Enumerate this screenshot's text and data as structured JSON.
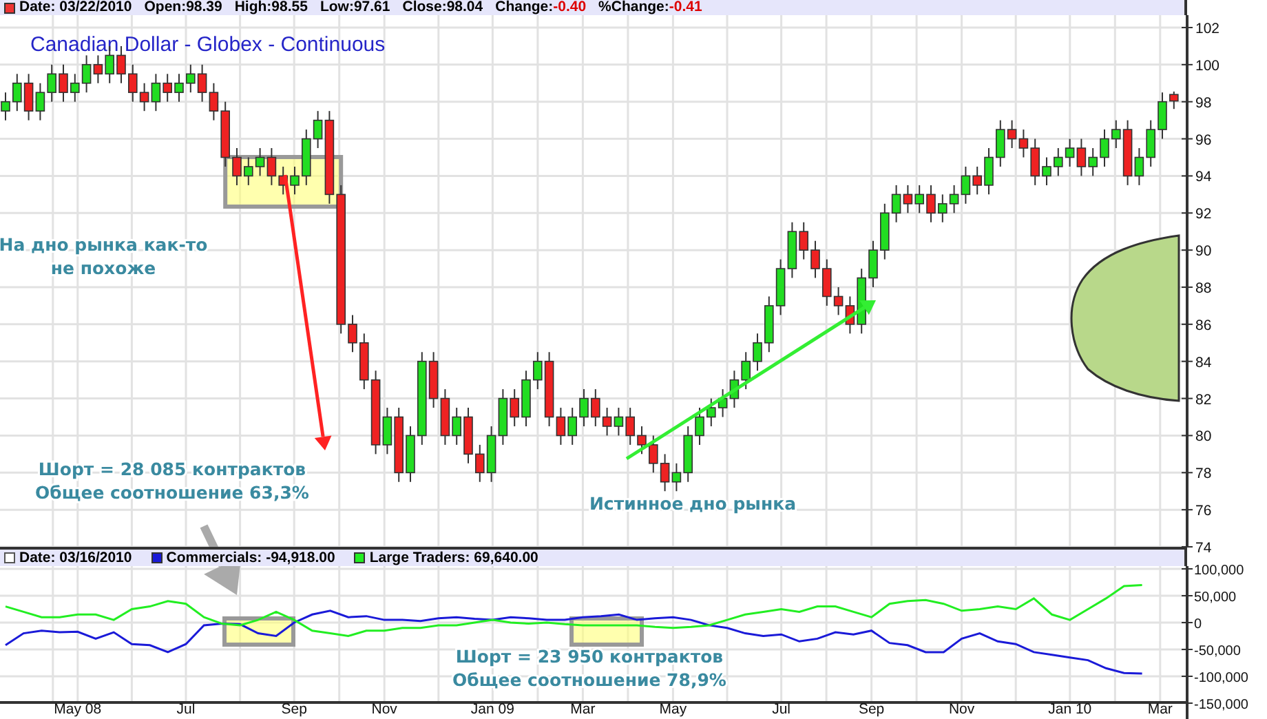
{
  "header": {
    "items": [
      {
        "kind": "date",
        "text": "Date: 03/22/2010"
      },
      {
        "kind": "plain",
        "text": "Open:98.39"
      },
      {
        "kind": "plain",
        "text": "High:98.55"
      },
      {
        "kind": "plain",
        "text": "Low:97.61"
      },
      {
        "kind": "plain",
        "text": "Close:98.04"
      },
      {
        "kind": "change",
        "label": "Change:",
        "value": "-0.40",
        "negative": true
      },
      {
        "kind": "change",
        "label": "%Change:",
        "value": "-0.41",
        "negative": true
      }
    ]
  },
  "price_chart": {
    "chart_data": {
      "type": "candlestick",
      "title": "Canadian Dollar - Globex - Continuous",
      "grid": true,
      "ylim": [
        74,
        102
      ],
      "yticks": [
        74,
        76,
        78,
        80,
        82,
        84,
        86,
        88,
        90,
        92,
        94,
        96,
        98,
        100,
        102
      ],
      "ohlc": [
        [
          97.5,
          98.5,
          97,
          98
        ],
        [
          98,
          99.5,
          97.5,
          99
        ],
        [
          99,
          99.5,
          97,
          97.5
        ],
        [
          97.5,
          99,
          97,
          98.5
        ],
        [
          98.5,
          100,
          98,
          99.5
        ],
        [
          99.5,
          100,
          98,
          98.5
        ],
        [
          98.5,
          99.5,
          98,
          99
        ],
        [
          99,
          100.5,
          98.5,
          100
        ],
        [
          100,
          100.5,
          99,
          99.5
        ],
        [
          99.5,
          101,
          99,
          100.5
        ],
        [
          100.5,
          101,
          99,
          99.5
        ],
        [
          99.5,
          100,
          98,
          98.5
        ],
        [
          98.5,
          99,
          97.5,
          98
        ],
        [
          98,
          99.5,
          97.5,
          99
        ],
        [
          99,
          99.5,
          98,
          98.5
        ],
        [
          98.5,
          99.5,
          98,
          99
        ],
        [
          99,
          100,
          98.5,
          99.5
        ],
        [
          99.5,
          100,
          98,
          98.5
        ],
        [
          98.5,
          99,
          97,
          97.5
        ],
        [
          97.5,
          98,
          94.5,
          95
        ],
        [
          95,
          95.5,
          93.5,
          94
        ],
        [
          94,
          95,
          93.5,
          94.5
        ],
        [
          94.5,
          95.5,
          94,
          95
        ],
        [
          95,
          95.5,
          93.5,
          94
        ],
        [
          94,
          94.5,
          93,
          93.5
        ],
        [
          93.5,
          94.5,
          93,
          94
        ],
        [
          94,
          96.5,
          93.5,
          96
        ],
        [
          96,
          97.5,
          95.5,
          97
        ],
        [
          97,
          97.5,
          92.5,
          93
        ],
        [
          93,
          93.5,
          85.5,
          86
        ],
        [
          86,
          86.5,
          84.5,
          85
        ],
        [
          85,
          85.5,
          82.5,
          83
        ],
        [
          83,
          83.5,
          79,
          79.5
        ],
        [
          79.5,
          81.5,
          79,
          81
        ],
        [
          81,
          81.5,
          77.5,
          78
        ],
        [
          78,
          80.5,
          77.5,
          80
        ],
        [
          80,
          84.5,
          79.5,
          84
        ],
        [
          84,
          84.5,
          81.5,
          82
        ],
        [
          82,
          82.5,
          79.5,
          80
        ],
        [
          80,
          81.5,
          79.5,
          81
        ],
        [
          81,
          81.5,
          78.5,
          79
        ],
        [
          79,
          79.5,
          77.5,
          78
        ],
        [
          78,
          80.5,
          77.5,
          80
        ],
        [
          80,
          82.5,
          79.5,
          82
        ],
        [
          82,
          82.5,
          80.5,
          81
        ],
        [
          81,
          83.5,
          80.5,
          83
        ],
        [
          83,
          84.5,
          82.5,
          84
        ],
        [
          84,
          84.5,
          80.5,
          81
        ],
        [
          81,
          81.5,
          79.5,
          80
        ],
        [
          80,
          81.5,
          79.5,
          81
        ],
        [
          81,
          82.5,
          80.5,
          82
        ],
        [
          82,
          82.5,
          80.5,
          81
        ],
        [
          81,
          81.5,
          80,
          80.5
        ],
        [
          80.5,
          81.5,
          80,
          81
        ],
        [
          81,
          81.5,
          79.5,
          80
        ],
        [
          80,
          80.5,
          79,
          79.5
        ],
        [
          79.5,
          80,
          78,
          78.5
        ],
        [
          78.5,
          79,
          77,
          77.5
        ],
        [
          77.5,
          78.5,
          77,
          78
        ],
        [
          78,
          80.5,
          77.5,
          80
        ],
        [
          80,
          81.5,
          79.5,
          81
        ],
        [
          81,
          82,
          80.5,
          81.5
        ],
        [
          81.5,
          82.5,
          81,
          82
        ],
        [
          82,
          83.5,
          81.5,
          83
        ],
        [
          83,
          84.5,
          82.5,
          84
        ],
        [
          84,
          85.5,
          83.5,
          85
        ],
        [
          85,
          87.5,
          84.5,
          87
        ],
        [
          87,
          89.5,
          86.5,
          89
        ],
        [
          89,
          91.5,
          88.5,
          91
        ],
        [
          91,
          91.5,
          89.5,
          90
        ],
        [
          90,
          90.5,
          88.5,
          89
        ],
        [
          89,
          89.5,
          87,
          87.5
        ],
        [
          87.5,
          88,
          86.5,
          87
        ],
        [
          87,
          87.5,
          85.5,
          86
        ],
        [
          86,
          89,
          85.5,
          88.5
        ],
        [
          88.5,
          90.5,
          88,
          90
        ],
        [
          90,
          92.5,
          89.5,
          92
        ],
        [
          92,
          93.5,
          91.5,
          93
        ],
        [
          93,
          93.5,
          92,
          92.5
        ],
        [
          92.5,
          93.5,
          92,
          93
        ],
        [
          93,
          93.5,
          91.5,
          92
        ],
        [
          92,
          93,
          91.5,
          92.5
        ],
        [
          92.5,
          93.5,
          92,
          93
        ],
        [
          93,
          94.5,
          92.5,
          94
        ],
        [
          94,
          94.5,
          93,
          93.5
        ],
        [
          93.5,
          95.5,
          93,
          95
        ],
        [
          95,
          97,
          94.5,
          96.5
        ],
        [
          96.5,
          97,
          95.5,
          96
        ],
        [
          96,
          96.5,
          95,
          95.5
        ],
        [
          95.5,
          96,
          93.5,
          94
        ],
        [
          94,
          95,
          93.5,
          94.5
        ],
        [
          94.5,
          95.5,
          94,
          95
        ],
        [
          95,
          96,
          94.5,
          95.5
        ],
        [
          95.5,
          96,
          94,
          94.5
        ],
        [
          94.5,
          95.5,
          94,
          95
        ],
        [
          95,
          96.5,
          94.5,
          96
        ],
        [
          96,
          97,
          95.5,
          96.5
        ],
        [
          96.5,
          97,
          93.5,
          94
        ],
        [
          94,
          95.5,
          93.5,
          95
        ],
        [
          95,
          97,
          94.5,
          96.5
        ],
        [
          96.5,
          98.5,
          96,
          98
        ],
        [
          98.39,
          98.55,
          97.61,
          98.04
        ]
      ]
    },
    "notes": [
      {
        "lines": [
          "На дно рынка как-то",
          "не похоже"
        ]
      },
      {
        "lines": [
          "Шорт = 28 085 контрактов",
          "Общее соотношение 63,3%"
        ]
      },
      {
        "lines": [
          "Истинное дно рынка"
        ]
      }
    ]
  },
  "cot_panel": {
    "legend": [
      {
        "kind": "date",
        "text": "Date: 03/16/2010"
      },
      {
        "kind": "series",
        "text": "Commercials: -94,918.00",
        "color": "#1a1ad8"
      },
      {
        "kind": "series",
        "text": "Large Traders: 69,640.00",
        "color": "#22ee22"
      }
    ],
    "chart_data": {
      "type": "line",
      "grid": true,
      "ylim": [
        -150000,
        100000
      ],
      "yticks": [
        {
          "value": 100000,
          "label": "100,000"
        },
        {
          "value": 50000,
          "label": "50,000"
        },
        {
          "value": 0,
          "label": "0"
        },
        {
          "value": -50000,
          "label": "-50,000"
        },
        {
          "value": -100000,
          "label": "-100,000"
        },
        {
          "value": -150000,
          "label": "-150,000"
        }
      ],
      "categories": [
        null,
        null,
        null,
        null,
        "May 08",
        null,
        null,
        null,
        null,
        null,
        "Jul",
        null,
        null,
        null,
        null,
        null,
        "Sep",
        null,
        null,
        null,
        null,
        "Nov",
        null,
        null,
        null,
        null,
        null,
        "Jan 09",
        null,
        null,
        null,
        null,
        "Mar",
        null,
        null,
        null,
        null,
        "May",
        null,
        null,
        null,
        null,
        null,
        "Jul",
        null,
        null,
        null,
        null,
        "Sep",
        null,
        null,
        null,
        null,
        "Nov",
        null,
        null,
        null,
        null,
        null,
        "Jan 10",
        null,
        null,
        null,
        null,
        "Mar"
      ],
      "series": [
        {
          "color": "#1a1ad8",
          "values": [
            -42000,
            -20000,
            -15000,
            -18000,
            -17000,
            -30000,
            -18000,
            -40000,
            -42000,
            -55000,
            -40000,
            -5000,
            -2000,
            -3000,
            -20000,
            -25000,
            0,
            15000,
            22000,
            10000,
            12000,
            5000,
            5000,
            3000,
            8000,
            10000,
            7000,
            5000,
            10000,
            8000,
            5000,
            5000,
            10000,
            12000,
            15000,
            5000,
            8000,
            10000,
            5000,
            -5000,
            -10000,
            -20000,
            -25000,
            -22000,
            -35000,
            -30000,
            -18000,
            -22000,
            -15000,
            -38000,
            -42000,
            -55000,
            -55000,
            -30000,
            -20000,
            -35000,
            -40000,
            -55000,
            -60000,
            -65000,
            -70000,
            -85000,
            -94000,
            -95000,
            null
          ]
        },
        {
          "color": "#22ee22",
          "values": [
            30000,
            20000,
            10000,
            10000,
            15000,
            15000,
            5000,
            25000,
            30000,
            40000,
            35000,
            10000,
            -2000,
            -5000,
            5000,
            20000,
            5000,
            -15000,
            -20000,
            -25000,
            -15000,
            -15000,
            -10000,
            -10000,
            -5000,
            -5000,
            0,
            5000,
            0,
            -2000,
            0,
            -3000,
            -5000,
            -5000,
            -5000,
            -5000,
            -8000,
            -10000,
            -8000,
            -5000,
            5000,
            15000,
            20000,
            25000,
            20000,
            30000,
            30000,
            20000,
            10000,
            35000,
            40000,
            42000,
            35000,
            22000,
            25000,
            30000,
            25000,
            45000,
            15000,
            5000,
            25000,
            45000,
            68000,
            70000,
            null
          ]
        }
      ]
    },
    "notes": [
      {
        "lines": [
          "Шорт = 23 950 контрактов",
          "Общее соотношение 78,9%"
        ]
      }
    ]
  }
}
